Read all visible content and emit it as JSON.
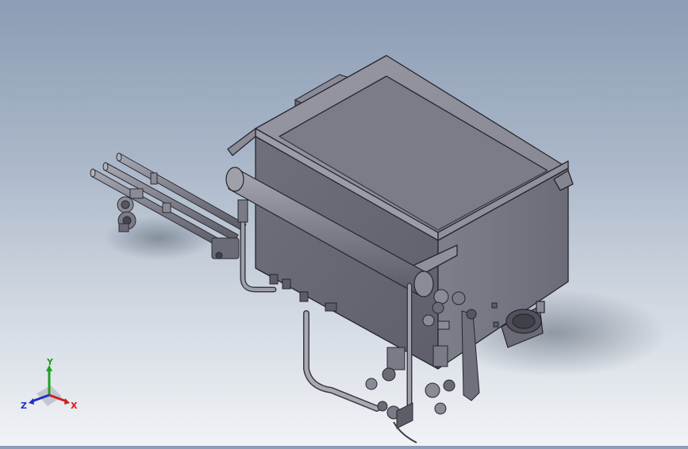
{
  "viewport": {
    "background_top": "#8d9db5",
    "background_bottom": "#f1f3f6",
    "model_color": "#7d7e8a"
  },
  "triad": {
    "x_label": "X",
    "y_label": "Y",
    "z_label": "Z",
    "x_color": "#cc2020",
    "y_color": "#20a020",
    "z_color": "#2030c0"
  }
}
